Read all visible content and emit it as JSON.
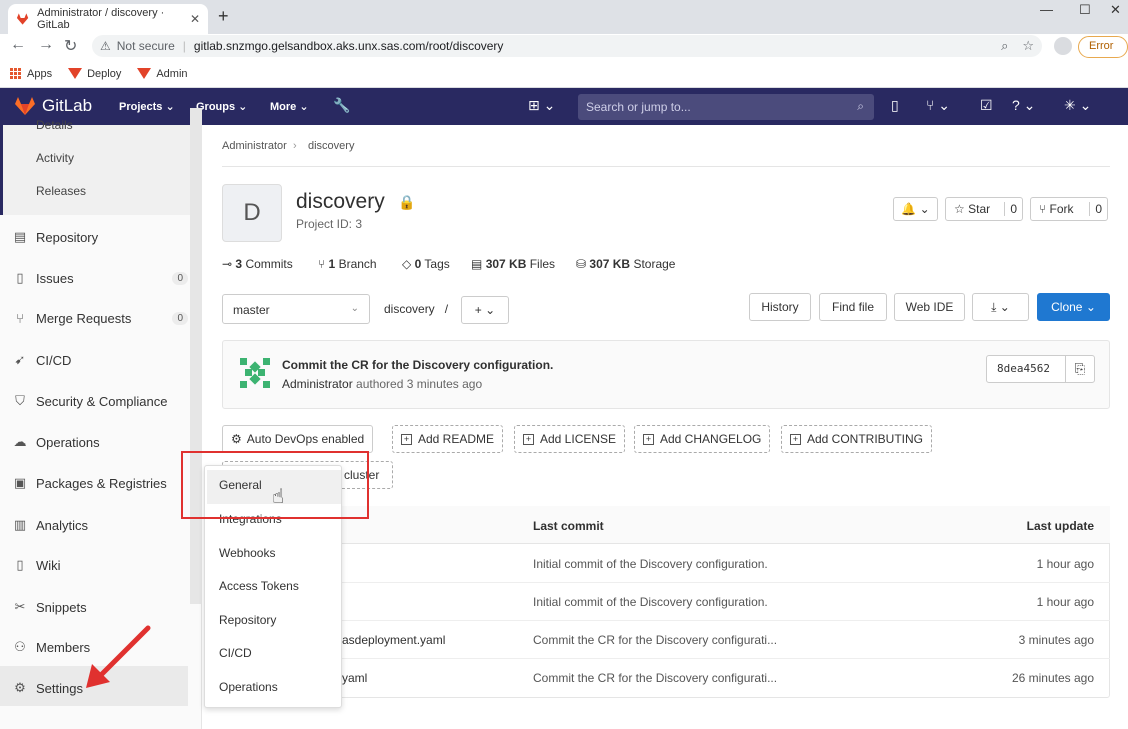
{
  "browser": {
    "tab_title": "Administrator / discovery · GitLab",
    "url": "gitlab.snzmgo.gelsandbox.aks.unx.sas.com/root/discovery",
    "security_label": "Not secure",
    "error_label": "Error",
    "bookmarks": [
      "Apps",
      "Deploy",
      "Admin"
    ]
  },
  "gitlab": {
    "brand": "GitLab",
    "nav": [
      "Projects",
      "Groups",
      "More"
    ],
    "search_placeholder": "Search or jump to..."
  },
  "sidebar": {
    "sub_items": [
      "Details",
      "Activity",
      "Releases"
    ],
    "items": [
      {
        "label": "Repository",
        "icon": "doc-icon"
      },
      {
        "label": "Issues",
        "icon": "issues-icon",
        "count": "0"
      },
      {
        "label": "Merge Requests",
        "icon": "merge-icon",
        "count": "0"
      },
      {
        "label": "CI/CD",
        "icon": "rocket-icon"
      },
      {
        "label": "Security & Compliance",
        "icon": "shield-icon"
      },
      {
        "label": "Operations",
        "icon": "cloud-icon"
      },
      {
        "label": "Packages & Registries",
        "icon": "package-icon"
      },
      {
        "label": "Analytics",
        "icon": "chart-icon"
      },
      {
        "label": "Wiki",
        "icon": "book-icon"
      },
      {
        "label": "Snippets",
        "icon": "scissors-icon"
      },
      {
        "label": "Members",
        "icon": "users-icon"
      },
      {
        "label": "Settings",
        "icon": "gear-icon"
      }
    ]
  },
  "flyout": {
    "items": [
      "General",
      "Integrations",
      "Webhooks",
      "Access Tokens",
      "Repository",
      "CI/CD",
      "Operations"
    ]
  },
  "breadcrumb": [
    "Administrator",
    "discovery"
  ],
  "project": {
    "avatar_letter": "D",
    "name": "discovery",
    "id_label": "Project ID: 3",
    "star_label": "Star",
    "star_count": "0",
    "fork_label": "Fork",
    "fork_count": "0",
    "stats": {
      "commits_num": "3",
      "commits_label": "Commits",
      "branch_num": "1",
      "branch_label": "Branch",
      "tags_num": "0",
      "tags_label": "Tags",
      "files_num": "307 KB",
      "files_label": "Files",
      "storage_num": "307 KB",
      "storage_label": "Storage"
    }
  },
  "repo": {
    "branch": "master",
    "path": "discovery",
    "sep": "/",
    "buttons": {
      "history": "History",
      "find_file": "Find file",
      "web_ide": "Web IDE",
      "clone": "Clone"
    }
  },
  "commit": {
    "message": "Commit the CR for the Discovery configuration.",
    "author": "Administrator",
    "meta": "authored 3 minutes ago",
    "sha": "8dea4562"
  },
  "quick_actions": {
    "auto_devops": "Auto DevOps enabled",
    "add_readme": "Add README",
    "add_license": "Add LICENSE",
    "add_changelog": "Add CHANGELOG",
    "add_contributing": "Add CONTRIBUTING",
    "cluster": "cluster"
  },
  "table": {
    "headers": {
      "last_commit": "Last commit",
      "last_update": "Last update"
    },
    "rows": [
      {
        "name": "",
        "commit": "Initial commit of the Discovery configuration.",
        "updated": "1 hour ago"
      },
      {
        "name": "",
        "commit": "Initial commit of the Discovery configuration.",
        "updated": "1 hour ago"
      },
      {
        "name": "asdeployment.yaml",
        "commit": "Commit the CR for the Discovery configurati...",
        "updated": "3 minutes ago"
      },
      {
        "name": "yaml",
        "commit": "Commit the CR for the Discovery configurati...",
        "updated": "26 minutes ago"
      }
    ]
  },
  "colors": {
    "header_bg": "#292961",
    "clone_bg": "#1f78d1",
    "highlight": "#e0312f"
  }
}
